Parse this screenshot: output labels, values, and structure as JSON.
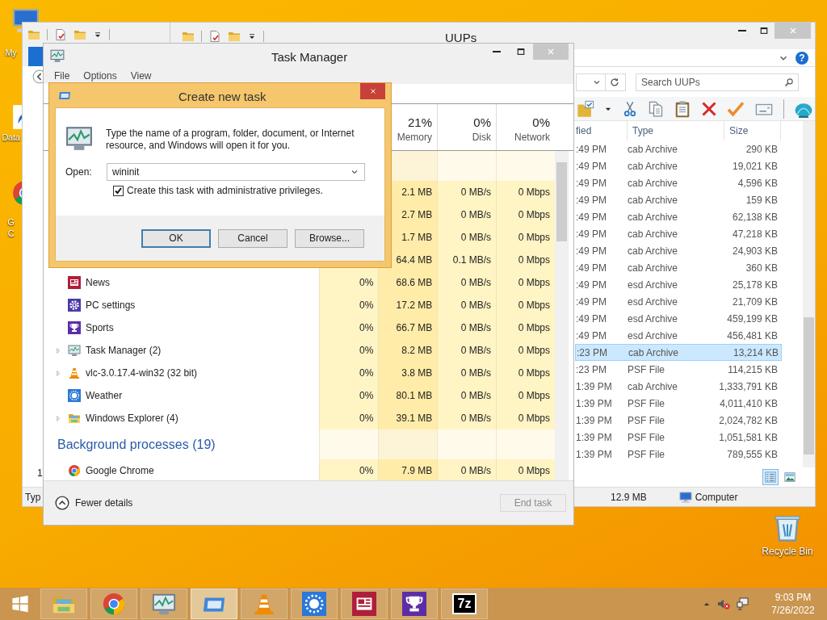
{
  "desktop_icons": [
    {
      "kind": "computer",
      "lines": [
        "My"
      ]
    },
    {
      "kind": "shortcut",
      "lines": [
        "Data"
      ]
    },
    {
      "kind": "chrome",
      "lines": [
        "G",
        "C"
      ]
    }
  ],
  "recycle_bin": {
    "label": "Recycle Bin"
  },
  "back_explorer": {
    "list_text": "1",
    "status_text": "Typ"
  },
  "explorer": {
    "title": "UUPs",
    "search": {
      "placeholder": "Search UUPs"
    },
    "help": "?",
    "columns": [
      "fied",
      "Type",
      "Size"
    ],
    "rows": [
      {
        "modified": ":49 PM",
        "type": "cab Archive",
        "size": "290 KB",
        "selected": false
      },
      {
        "modified": ":49 PM",
        "type": "cab Archive",
        "size": "19,021 KB",
        "selected": false
      },
      {
        "modified": ":49 PM",
        "type": "cab Archive",
        "size": "4,596 KB",
        "selected": false
      },
      {
        "modified": ":49 PM",
        "type": "cab Archive",
        "size": "159 KB",
        "selected": false
      },
      {
        "modified": ":49 PM",
        "type": "cab Archive",
        "size": "62,138 KB",
        "selected": false
      },
      {
        "modified": ":49 PM",
        "type": "cab Archive",
        "size": "47,218 KB",
        "selected": false
      },
      {
        "modified": ":49 PM",
        "type": "cab Archive",
        "size": "24,903 KB",
        "selected": false
      },
      {
        "modified": ":49 PM",
        "type": "cab Archive",
        "size": "360 KB",
        "selected": false
      },
      {
        "modified": ":49 PM",
        "type": "esd Archive",
        "size": "25,178 KB",
        "selected": false
      },
      {
        "modified": ":49 PM",
        "type": "esd Archive",
        "size": "21,709 KB",
        "selected": false
      },
      {
        "modified": ":49 PM",
        "type": "esd Archive",
        "size": "459,199 KB",
        "selected": false
      },
      {
        "modified": ":49 PM",
        "type": "esd Archive",
        "size": "456,481 KB",
        "selected": false
      },
      {
        "modified": ":23 PM",
        "type": "cab Archive",
        "size": "13,214 KB",
        "selected": true
      },
      {
        "modified": ":23 PM",
        "type": "PSF File",
        "size": "114,215 KB",
        "selected": false
      },
      {
        "modified": "1:39 PM",
        "type": "cab Archive",
        "size": "1,333,791 KB",
        "selected": false
      },
      {
        "modified": "1:39 PM",
        "type": "PSF File",
        "size": "4,011,410 KB",
        "selected": false
      },
      {
        "modified": "1:39 PM",
        "type": "PSF File",
        "size": "2,024,782 KB",
        "selected": false
      },
      {
        "modified": "1:39 PM",
        "type": "PSF File",
        "size": "1,051,581 KB",
        "selected": false
      },
      {
        "modified": "1:39 PM",
        "type": "PSF File",
        "size": "789,555 KB",
        "selected": false
      }
    ],
    "status_bar": {
      "size": "12.9 MB",
      "location": "Computer"
    }
  },
  "task_manager": {
    "title": "Task Manager",
    "menu": [
      "File",
      "Options",
      "View"
    ],
    "columns": [
      {
        "percent": "21%",
        "label": "Memory"
      },
      {
        "percent": "0%",
        "label": "Disk"
      },
      {
        "percent": "0%",
        "label": "Network"
      }
    ],
    "rows": [
      {
        "kind": "group"
      },
      {
        "kind": "process",
        "memory": "2.1 MB",
        "disk": "0 MB/s",
        "network": "0 Mbps"
      },
      {
        "kind": "process",
        "memory": "2.7 MB",
        "disk": "0 MB/s",
        "network": "0 Mbps"
      },
      {
        "kind": "process",
        "memory": "1.7 MB",
        "disk": "0 MB/s",
        "network": "0 Mbps"
      },
      {
        "kind": "process",
        "memory": "64.4 MB",
        "disk": "0.1 MB/s",
        "network": "0 Mbps"
      },
      {
        "kind": "process",
        "name": "News",
        "expandable": false,
        "cpu": "0%",
        "memory": "68.6 MB",
        "disk": "0 MB/s",
        "network": "0 Mbps"
      },
      {
        "kind": "process",
        "name": "PC settings",
        "expandable": false,
        "cpu": "0%",
        "memory": "17.2 MB",
        "disk": "0 MB/s",
        "network": "0 Mbps"
      },
      {
        "kind": "process",
        "name": "Sports",
        "expandable": false,
        "cpu": "0%",
        "memory": "66.7 MB",
        "disk": "0 MB/s",
        "network": "0 Mbps"
      },
      {
        "kind": "process",
        "name": "Task Manager (2)",
        "expandable": true,
        "cpu": "0%",
        "memory": "8.2 MB",
        "disk": "0 MB/s",
        "network": "0 Mbps"
      },
      {
        "kind": "process",
        "name": "vlc-3.0.17.4-win32 (32 bit)",
        "expandable": true,
        "cpu": "0%",
        "memory": "3.8 MB",
        "disk": "0 MB/s",
        "network": "0 Mbps"
      },
      {
        "kind": "process",
        "name": "Weather",
        "expandable": false,
        "cpu": "0%",
        "memory": "80.1 MB",
        "disk": "0 MB/s",
        "network": "0 Mbps"
      },
      {
        "kind": "process",
        "name": "Windows Explorer (4)",
        "expandable": true,
        "cpu": "0%",
        "memory": "39.1 MB",
        "disk": "0 MB/s",
        "network": "0 Mbps"
      },
      {
        "kind": "group",
        "label": "Background processes (19)"
      },
      {
        "kind": "process",
        "name": "Google Chrome",
        "expandable": false,
        "cpu": "0%",
        "memory": "7.9 MB",
        "disk": "0 MB/s",
        "network": "0 Mbps"
      }
    ],
    "toggle": "Fewer details",
    "end_task": {
      "label": "End task",
      "disabled": true
    }
  },
  "dialog": {
    "title": "Create new task",
    "message": "Type the name of a program, folder, document, or Internet resource, and Windows will open it for you.",
    "open_label": "Open:",
    "open_value": "wininit",
    "admin": {
      "label": "Create this task with administrative privileges.",
      "checked": true
    },
    "buttons": [
      {
        "label": "OK",
        "default": true
      },
      {
        "label": "Cancel",
        "default": false
      },
      {
        "label": "Browse...",
        "default": false
      }
    ]
  },
  "taskbar": {
    "items": [
      {
        "selected": false
      },
      {
        "selected": false
      },
      {
        "selected": false
      },
      {
        "selected": true
      },
      {
        "selected": false
      },
      {
        "selected": false
      },
      {
        "selected": false
      },
      {
        "selected": false
      },
      {
        "label": "7z",
        "selected": false
      }
    ],
    "clock": {
      "time": "9:03 PM",
      "date": "7/26/2022"
    }
  }
}
